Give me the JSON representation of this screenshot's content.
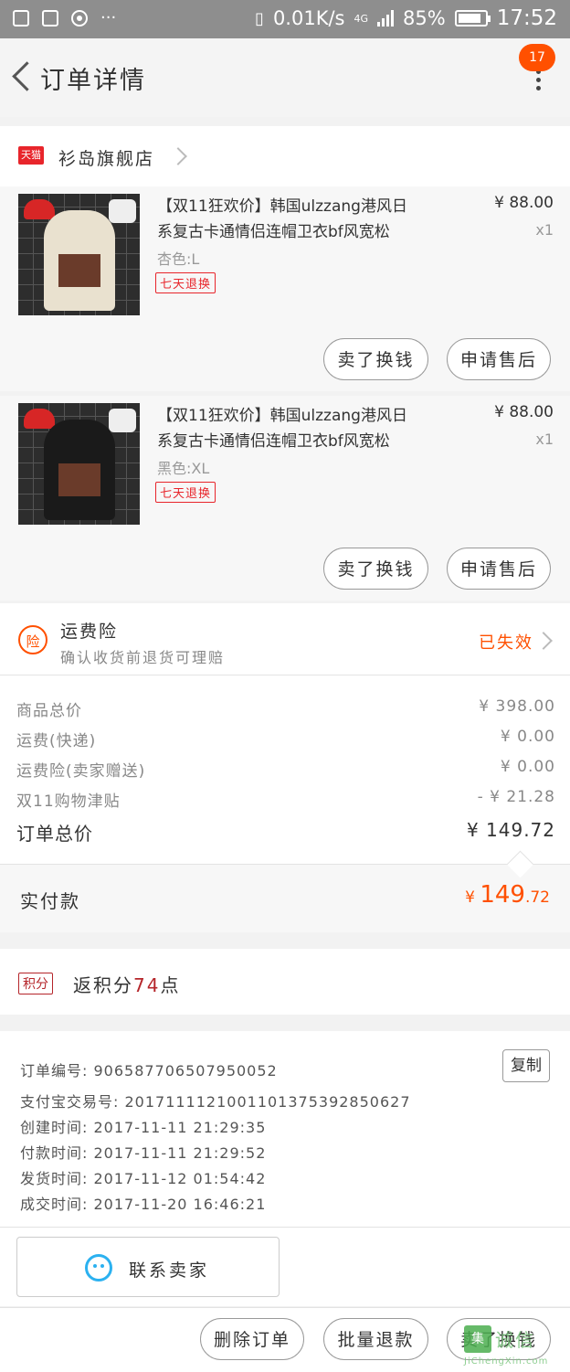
{
  "status_bar": {
    "net_speed": "0.01K/s",
    "network": "4G",
    "battery_pct": "85%",
    "battery_level": 0.85,
    "time": "17:52"
  },
  "header": {
    "title": "订单详情",
    "badge_count": "17"
  },
  "store": {
    "platform_tag": "天猫",
    "name": "衫岛旗舰店"
  },
  "products": [
    {
      "title_line1": "【双11狂欢价】韩国ulzzang港风日",
      "title_line2": "系复古卡通情侣连帽卫衣bf风宽松",
      "attr": "杏色:L",
      "tag": "七天退换",
      "price": "¥ 88.00",
      "qty": "x1",
      "hoodie_color": "#e9e1cf",
      "btn_sell": "卖了换钱",
      "btn_after": "申请售后"
    },
    {
      "title_line1": "【双11狂欢价】韩国ulzzang港风日",
      "title_line2": "系复古卡通情侣连帽卫衣bf风宽松",
      "attr": "黑色:XL",
      "tag": "七天退换",
      "price": "¥ 88.00",
      "qty": "x1",
      "hoodie_color": "#1a1a1a",
      "btn_sell": "卖了换钱",
      "btn_after": "申请售后"
    }
  ],
  "insurance": {
    "icon_char": "险",
    "title": "运费险",
    "subtitle": "确认收货前退货可理赔",
    "status": "已失效"
  },
  "breakdown": [
    {
      "label": "商品总价",
      "value": "¥ 398.00"
    },
    {
      "label": "运费(快递)",
      "value": "¥ 0.00"
    },
    {
      "label": "运费险(卖家赠送)",
      "value": "¥ 0.00"
    },
    {
      "label": "双11购物津贴",
      "value": "- ¥ 21.28"
    }
  ],
  "order_total": {
    "label": "订单总价",
    "value": "¥ 149.72"
  },
  "paid": {
    "label": "实付款",
    "currency": "¥ ",
    "int": "149",
    "dec": ".72"
  },
  "points": {
    "tag": "积分",
    "prefix": "返积分",
    "num": "74",
    "suffix": "点"
  },
  "order_info": {
    "order_no": "订单编号: 906587706507950052",
    "alipay_no": "支付宝交易号: 2017111121001101375392850627",
    "created": "创建时间: 2017-11-11 21:29:35",
    "paid": "付款时间: 2017-11-11 21:29:52",
    "shipped": "发货时间: 2017-11-12 01:54:42",
    "completed": "成交时间: 2017-11-20 16:46:21",
    "copy_label": "复制"
  },
  "contact": {
    "label": "联系卖家"
  },
  "bottom_actions": {
    "delete": "删除订单",
    "batch_refund": "批量退款",
    "sell": "卖了换钱"
  },
  "watermark": {
    "main": "诚信",
    "box": "集",
    "sub": "JiChengXin.com"
  }
}
